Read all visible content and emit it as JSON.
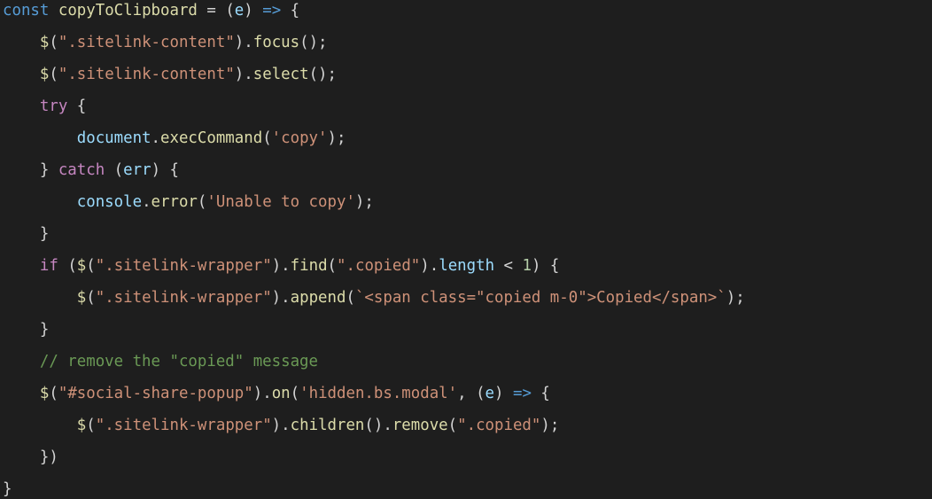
{
  "colors": {
    "background": "#1e1e1e",
    "default": "#d4d4d4",
    "storage": "#569cd6",
    "function": "#dcdcaa",
    "variable": "#9cdcfe",
    "string": "#ce9178",
    "keyword": "#c586c0",
    "number": "#b5cea8",
    "comment": "#6a9955"
  },
  "code": {
    "lines": [
      [
        {
          "t": "const",
          "c": "storage"
        },
        {
          "t": " ",
          "c": "punct"
        },
        {
          "t": "copyToClipboard",
          "c": "func"
        },
        {
          "t": " = (",
          "c": "punct"
        },
        {
          "t": "e",
          "c": "var"
        },
        {
          "t": ") ",
          "c": "punct"
        },
        {
          "t": "=>",
          "c": "storage"
        },
        {
          "t": " {",
          "c": "punct"
        }
      ],
      [
        {
          "t": "    ",
          "c": "punct"
        },
        {
          "t": "$",
          "c": "func"
        },
        {
          "t": "(",
          "c": "punct"
        },
        {
          "t": "\".sitelink-content\"",
          "c": "string"
        },
        {
          "t": ").",
          "c": "punct"
        },
        {
          "t": "focus",
          "c": "func"
        },
        {
          "t": "();",
          "c": "punct"
        }
      ],
      [
        {
          "t": "    ",
          "c": "punct"
        },
        {
          "t": "$",
          "c": "func"
        },
        {
          "t": "(",
          "c": "punct"
        },
        {
          "t": "\".sitelink-content\"",
          "c": "string"
        },
        {
          "t": ").",
          "c": "punct"
        },
        {
          "t": "select",
          "c": "func"
        },
        {
          "t": "();",
          "c": "punct"
        }
      ],
      [
        {
          "t": "    ",
          "c": "punct"
        },
        {
          "t": "try",
          "c": "keyword"
        },
        {
          "t": " {",
          "c": "punct"
        }
      ],
      [
        {
          "t": "        ",
          "c": "punct"
        },
        {
          "t": "document",
          "c": "var"
        },
        {
          "t": ".",
          "c": "punct"
        },
        {
          "t": "execCommand",
          "c": "func"
        },
        {
          "t": "(",
          "c": "punct"
        },
        {
          "t": "'copy'",
          "c": "string"
        },
        {
          "t": ");",
          "c": "punct"
        }
      ],
      [
        {
          "t": "    } ",
          "c": "punct"
        },
        {
          "t": "catch",
          "c": "keyword"
        },
        {
          "t": " (",
          "c": "punct"
        },
        {
          "t": "err",
          "c": "var"
        },
        {
          "t": ") {",
          "c": "punct"
        }
      ],
      [
        {
          "t": "        ",
          "c": "punct"
        },
        {
          "t": "console",
          "c": "var"
        },
        {
          "t": ".",
          "c": "punct"
        },
        {
          "t": "error",
          "c": "func"
        },
        {
          "t": "(",
          "c": "punct"
        },
        {
          "t": "'Unable to copy'",
          "c": "string"
        },
        {
          "t": ");",
          "c": "punct"
        }
      ],
      [
        {
          "t": "    }",
          "c": "punct"
        }
      ],
      [
        {
          "t": "    ",
          "c": "punct"
        },
        {
          "t": "if",
          "c": "keyword"
        },
        {
          "t": " (",
          "c": "punct"
        },
        {
          "t": "$",
          "c": "func"
        },
        {
          "t": "(",
          "c": "punct"
        },
        {
          "t": "\".sitelink-wrapper\"",
          "c": "string"
        },
        {
          "t": ").",
          "c": "punct"
        },
        {
          "t": "find",
          "c": "func"
        },
        {
          "t": "(",
          "c": "punct"
        },
        {
          "t": "\".copied\"",
          "c": "string"
        },
        {
          "t": ").",
          "c": "punct"
        },
        {
          "t": "length",
          "c": "var"
        },
        {
          "t": " < ",
          "c": "punct"
        },
        {
          "t": "1",
          "c": "number"
        },
        {
          "t": ") {",
          "c": "punct"
        }
      ],
      [
        {
          "t": "        ",
          "c": "punct"
        },
        {
          "t": "$",
          "c": "func"
        },
        {
          "t": "(",
          "c": "punct"
        },
        {
          "t": "\".sitelink-wrapper\"",
          "c": "string"
        },
        {
          "t": ").",
          "c": "punct"
        },
        {
          "t": "append",
          "c": "func"
        },
        {
          "t": "(",
          "c": "punct"
        },
        {
          "t": "`<span class=\"copied m-0\">Copied</span>`",
          "c": "string"
        },
        {
          "t": ");",
          "c": "punct"
        }
      ],
      [
        {
          "t": "    }",
          "c": "punct"
        }
      ],
      [
        {
          "t": "    ",
          "c": "punct"
        },
        {
          "t": "// remove the \"copied\" message",
          "c": "comment"
        }
      ],
      [
        {
          "t": "    ",
          "c": "punct"
        },
        {
          "t": "$",
          "c": "func"
        },
        {
          "t": "(",
          "c": "punct"
        },
        {
          "t": "\"#social-share-popup\"",
          "c": "string"
        },
        {
          "t": ").",
          "c": "punct"
        },
        {
          "t": "on",
          "c": "func"
        },
        {
          "t": "(",
          "c": "punct"
        },
        {
          "t": "'hidden.bs.modal'",
          "c": "string"
        },
        {
          "t": ", (",
          "c": "punct"
        },
        {
          "t": "e",
          "c": "var"
        },
        {
          "t": ") ",
          "c": "punct"
        },
        {
          "t": "=>",
          "c": "storage"
        },
        {
          "t": " {",
          "c": "punct"
        }
      ],
      [
        {
          "t": "        ",
          "c": "punct"
        },
        {
          "t": "$",
          "c": "func"
        },
        {
          "t": "(",
          "c": "punct"
        },
        {
          "t": "\".sitelink-wrapper\"",
          "c": "string"
        },
        {
          "t": ").",
          "c": "punct"
        },
        {
          "t": "children",
          "c": "func"
        },
        {
          "t": "().",
          "c": "punct"
        },
        {
          "t": "remove",
          "c": "func"
        },
        {
          "t": "(",
          "c": "punct"
        },
        {
          "t": "\".copied\"",
          "c": "string"
        },
        {
          "t": ");",
          "c": "punct"
        }
      ],
      [
        {
          "t": "    })",
          "c": "punct"
        }
      ],
      [
        {
          "t": "}",
          "c": "punct"
        }
      ]
    ]
  }
}
